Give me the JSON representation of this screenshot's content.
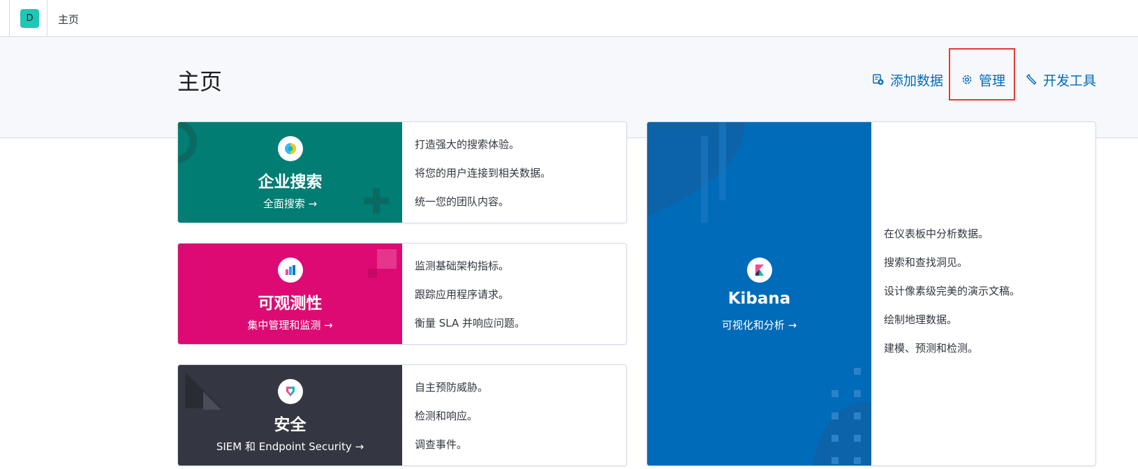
{
  "header": {
    "avatar_letter": "D",
    "breadcrumb": "主页"
  },
  "page": {
    "title": "主页",
    "links": {
      "add_data": "添加数据",
      "management": "管理",
      "dev_tools": "开发工具"
    }
  },
  "cards": {
    "enterprise_search": {
      "title": "企业搜索",
      "link": "全面搜索 →",
      "color": "#017d73",
      "lines": [
        "打造强大的搜索体验。",
        "将您的用户连接到相关数据。",
        "统一您的团队内容。"
      ]
    },
    "observability": {
      "title": "可观测性",
      "link": "集中管理和监测 →",
      "color": "#dd0a73",
      "lines": [
        "监测基础架构指标。",
        "跟踪应用程序请求。",
        "衡量 SLA 并响应问题。"
      ]
    },
    "security": {
      "title": "安全",
      "link": "SIEM 和 Endpoint Security →",
      "color": "#343741",
      "lines": [
        "自主预防威胁。",
        "检测和响应。",
        "调查事件。"
      ]
    },
    "kibana": {
      "title": "Kibana",
      "link": "可视化和分析 →",
      "color": "#006bb8",
      "lines": [
        "在仪表板中分析数据。",
        "搜索和查找洞见。",
        "设计像素级完美的演示文稿。",
        "绘制地理数据。",
        "建模、预测和检测。"
      ]
    }
  },
  "colors": {
    "accent": "#006bb8",
    "highlight": "#e7383a",
    "avatar": "#20c6b6"
  }
}
